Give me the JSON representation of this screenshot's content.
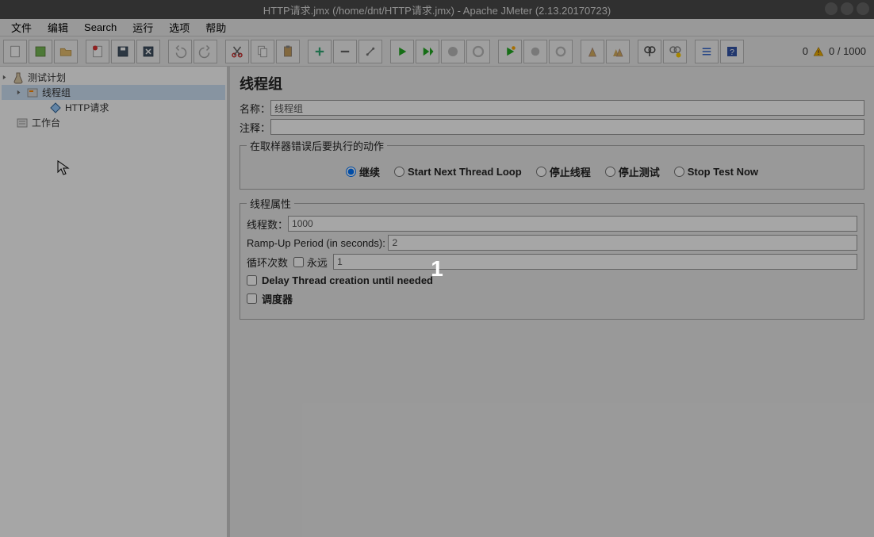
{
  "title": "HTTP请求.jmx (/home/dnt/HTTP请求.jmx) - Apache JMeter (2.13.20170723)",
  "overlay_text": "1",
  "menu": {
    "file": "文件",
    "edit": "编辑",
    "search": "Search",
    "run": "运行",
    "options": "选项",
    "help": "帮助"
  },
  "status": {
    "left_count": "0",
    "right_count": "0 / 1000"
  },
  "tree": {
    "root": "测试计划",
    "thread_group": "线程组",
    "http_request": "HTTP请求",
    "workbench": "工作台"
  },
  "panel": {
    "title": "线程组",
    "name_label": "名称：",
    "name_value": "线程组",
    "comment_label": "注释：",
    "comment_value": "",
    "action_group_label": "在取样器错误后要执行的动作",
    "radios": {
      "continue": "继续",
      "start_next": "Start Next Thread Loop",
      "stop_thread": "停止线程",
      "stop_test": "停止测试",
      "stop_now": "Stop Test Now"
    },
    "props_group_label": "线程属性",
    "threads_label": "线程数：",
    "threads_value": "1000",
    "rampup_label": "Ramp-Up Period (in seconds):",
    "rampup_value": "2",
    "loop_label": "循环次数",
    "loop_forever_label": "永远",
    "loop_value": "1",
    "delay_label": "Delay Thread creation until needed",
    "scheduler_label": "调度器"
  }
}
